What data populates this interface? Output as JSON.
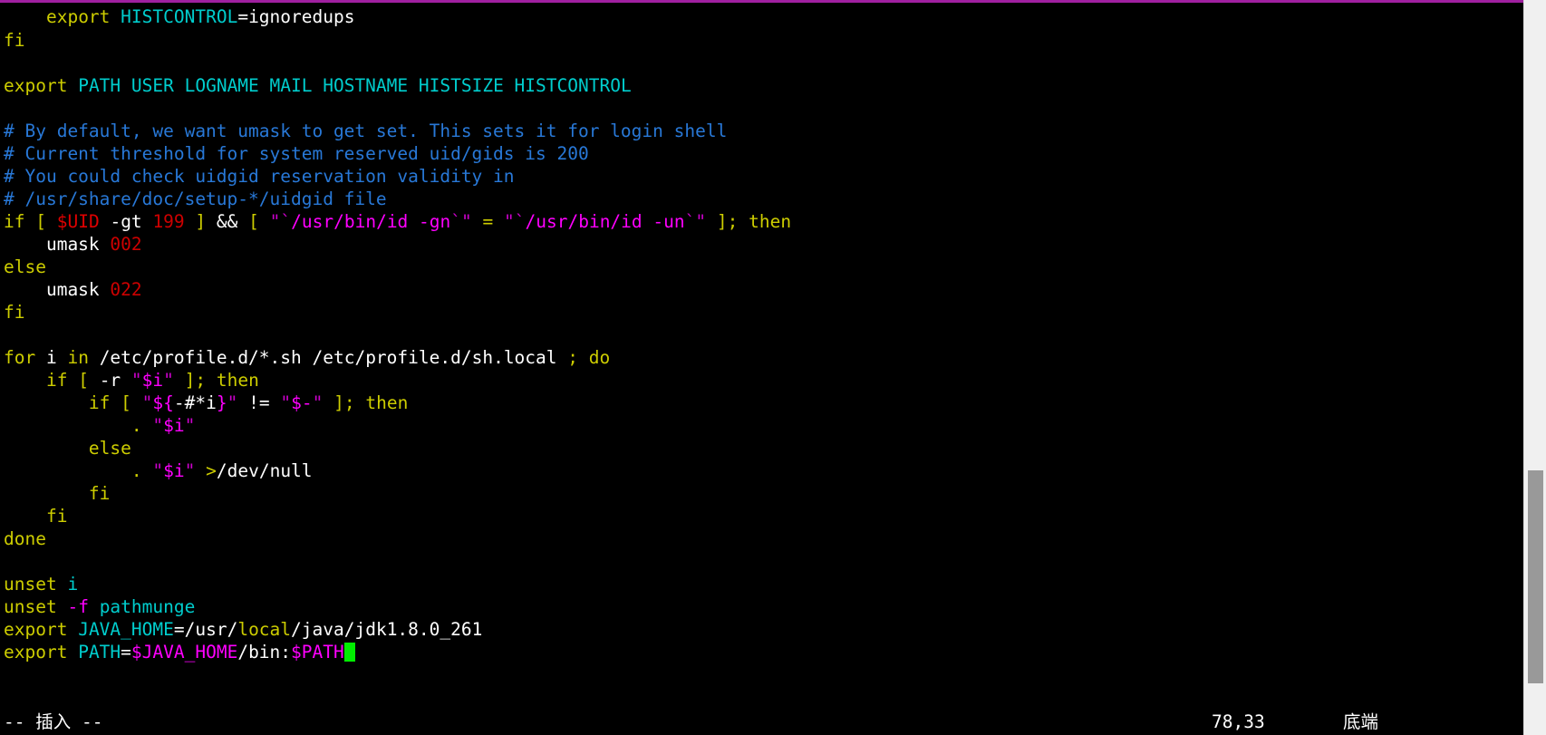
{
  "window": {
    "type": "terminal-vim-editor",
    "accent_color": "#a020a0",
    "background": "#000000",
    "foreground": "#ffffff"
  },
  "editor": {
    "file_syntax": "bash",
    "cursor_glyph": " ",
    "cursor_color": "#00ee00",
    "lines": [
      {
        "id": 1,
        "text": "    export HISTCONTROL=ignoredups",
        "tokens": [
          {
            "t": "    ",
            "c": "plain"
          },
          {
            "t": "export",
            "c": "kw"
          },
          {
            "t": " ",
            "c": "plain"
          },
          {
            "t": "HISTCONTROL",
            "c": "ident"
          },
          {
            "t": "=",
            "c": "plain"
          },
          {
            "t": "ignoredups",
            "c": "plain"
          }
        ]
      },
      {
        "id": 2,
        "text": "fi",
        "tokens": [
          {
            "t": "fi",
            "c": "kw"
          }
        ]
      },
      {
        "id": 3,
        "text": "",
        "tokens": []
      },
      {
        "id": 4,
        "text": "export PATH USER LOGNAME MAIL HOSTNAME HISTSIZE HISTCONTROL",
        "tokens": [
          {
            "t": "export",
            "c": "kw"
          },
          {
            "t": " ",
            "c": "plain"
          },
          {
            "t": "PATH USER LOGNAME MAIL HOSTNAME HISTSIZE HISTCONTROL",
            "c": "ident"
          }
        ]
      },
      {
        "id": 5,
        "text": "",
        "tokens": []
      },
      {
        "id": 6,
        "text": "# By default, we want umask to get set. This sets it for login shell",
        "tokens": [
          {
            "t": "# By default, we want umask to get set. This sets it for login shell",
            "c": "cmt"
          }
        ]
      },
      {
        "id": 7,
        "text": "# Current threshold for system reserved uid/gids is 200",
        "tokens": [
          {
            "t": "# Current threshold for system reserved uid/gids is 200",
            "c": "cmt"
          }
        ]
      },
      {
        "id": 8,
        "text": "# You could check uidgid reservation validity in",
        "tokens": [
          {
            "t": "# You could check uidgid reservation validity in",
            "c": "cmt"
          }
        ]
      },
      {
        "id": 9,
        "text": "# /usr/share/doc/setup-*/uidgid file",
        "tokens": [
          {
            "t": "# /usr/share/doc/setup-*/uidgid file",
            "c": "cmt"
          }
        ]
      },
      {
        "id": 10,
        "text": "if [ $UID -gt 199 ] && [ \"`/usr/bin/id -gn`\" = \"`/usr/bin/id -un`\" ]; then",
        "tokens": [
          {
            "t": "if",
            "c": "kw"
          },
          {
            "t": " ",
            "c": "plain"
          },
          {
            "t": "[",
            "c": "kw"
          },
          {
            "t": " ",
            "c": "plain"
          },
          {
            "t": "$UID",
            "c": "var2"
          },
          {
            "t": " ",
            "c": "plain"
          },
          {
            "t": "-gt",
            "c": "plain"
          },
          {
            "t": " ",
            "c": "plain"
          },
          {
            "t": "199",
            "c": "num"
          },
          {
            "t": " ",
            "c": "plain"
          },
          {
            "t": "]",
            "c": "kw"
          },
          {
            "t": " ",
            "c": "plain"
          },
          {
            "t": "&&",
            "c": "plain"
          },
          {
            "t": " ",
            "c": "plain"
          },
          {
            "t": "[",
            "c": "kw"
          },
          {
            "t": " ",
            "c": "plain"
          },
          {
            "t": "\"",
            "c": "str"
          },
          {
            "t": "`",
            "c": "str"
          },
          {
            "t": "/usr/bin/id -gn",
            "c": "var"
          },
          {
            "t": "`",
            "c": "str"
          },
          {
            "t": "\"",
            "c": "str"
          },
          {
            "t": " ",
            "c": "plain"
          },
          {
            "t": "=",
            "c": "kw"
          },
          {
            "t": " ",
            "c": "plain"
          },
          {
            "t": "\"",
            "c": "str"
          },
          {
            "t": "`",
            "c": "str"
          },
          {
            "t": "/usr/bin/id -un",
            "c": "var"
          },
          {
            "t": "`",
            "c": "str"
          },
          {
            "t": "\"",
            "c": "str"
          },
          {
            "t": " ",
            "c": "plain"
          },
          {
            "t": "]",
            "c": "kw"
          },
          {
            "t": ";",
            "c": "kw"
          },
          {
            "t": " ",
            "c": "plain"
          },
          {
            "t": "then",
            "c": "kw"
          }
        ]
      },
      {
        "id": 11,
        "text": "    umask 002",
        "tokens": [
          {
            "t": "    umask ",
            "c": "plain"
          },
          {
            "t": "002",
            "c": "num"
          }
        ]
      },
      {
        "id": 12,
        "text": "else",
        "tokens": [
          {
            "t": "else",
            "c": "kw"
          }
        ]
      },
      {
        "id": 13,
        "text": "    umask 022",
        "tokens": [
          {
            "t": "    umask ",
            "c": "plain"
          },
          {
            "t": "022",
            "c": "num"
          }
        ]
      },
      {
        "id": 14,
        "text": "fi",
        "tokens": [
          {
            "t": "fi",
            "c": "kw"
          }
        ]
      },
      {
        "id": 15,
        "text": "",
        "tokens": []
      },
      {
        "id": 16,
        "text": "for i in /etc/profile.d/*.sh /etc/profile.d/sh.local ; do",
        "tokens": [
          {
            "t": "for",
            "c": "kw"
          },
          {
            "t": " i ",
            "c": "plain"
          },
          {
            "t": "in",
            "c": "kw"
          },
          {
            "t": " /etc/profile.d/*.sh /etc/profile.d/sh.local ",
            "c": "plain"
          },
          {
            "t": ";",
            "c": "kw"
          },
          {
            "t": " ",
            "c": "plain"
          },
          {
            "t": "do",
            "c": "kw"
          }
        ]
      },
      {
        "id": 17,
        "text": "    if [ -r \"$i\" ]; then",
        "tokens": [
          {
            "t": "    ",
            "c": "plain"
          },
          {
            "t": "if",
            "c": "kw"
          },
          {
            "t": " ",
            "c": "plain"
          },
          {
            "t": "[",
            "c": "kw"
          },
          {
            "t": " -r ",
            "c": "plain"
          },
          {
            "t": "\"",
            "c": "str"
          },
          {
            "t": "$i",
            "c": "var"
          },
          {
            "t": "\"",
            "c": "str"
          },
          {
            "t": " ",
            "c": "plain"
          },
          {
            "t": "]",
            "c": "kw"
          },
          {
            "t": ";",
            "c": "kw"
          },
          {
            "t": " ",
            "c": "plain"
          },
          {
            "t": "then",
            "c": "kw"
          }
        ]
      },
      {
        "id": 18,
        "text": "        if [ \"${-#*i}\" != \"$-\" ]; then",
        "tokens": [
          {
            "t": "        ",
            "c": "plain"
          },
          {
            "t": "if",
            "c": "kw"
          },
          {
            "t": " ",
            "c": "plain"
          },
          {
            "t": "[",
            "c": "kw"
          },
          {
            "t": " ",
            "c": "plain"
          },
          {
            "t": "\"",
            "c": "str"
          },
          {
            "t": "${",
            "c": "var"
          },
          {
            "t": "-#*",
            "c": "plain"
          },
          {
            "t": "i",
            "c": "plain"
          },
          {
            "t": "}",
            "c": "var"
          },
          {
            "t": "\"",
            "c": "str"
          },
          {
            "t": " ",
            "c": "plain"
          },
          {
            "t": "!=",
            "c": "plain"
          },
          {
            "t": " ",
            "c": "plain"
          },
          {
            "t": "\"",
            "c": "str"
          },
          {
            "t": "$-",
            "c": "var"
          },
          {
            "t": "\"",
            "c": "str"
          },
          {
            "t": " ",
            "c": "plain"
          },
          {
            "t": "]",
            "c": "kw"
          },
          {
            "t": ";",
            "c": "kw"
          },
          {
            "t": " ",
            "c": "plain"
          },
          {
            "t": "then",
            "c": "kw"
          }
        ]
      },
      {
        "id": 19,
        "text": "            . \"$i\"",
        "tokens": [
          {
            "t": "            ",
            "c": "plain"
          },
          {
            "t": ".",
            "c": "kw"
          },
          {
            "t": " ",
            "c": "plain"
          },
          {
            "t": "\"",
            "c": "str"
          },
          {
            "t": "$i",
            "c": "var"
          },
          {
            "t": "\"",
            "c": "str"
          }
        ]
      },
      {
        "id": 20,
        "text": "        else",
        "tokens": [
          {
            "t": "        ",
            "c": "plain"
          },
          {
            "t": "else",
            "c": "kw"
          }
        ]
      },
      {
        "id": 21,
        "text": "            . \"$i\" >/dev/null",
        "tokens": [
          {
            "t": "            ",
            "c": "plain"
          },
          {
            "t": ".",
            "c": "kw"
          },
          {
            "t": " ",
            "c": "plain"
          },
          {
            "t": "\"",
            "c": "str"
          },
          {
            "t": "$i",
            "c": "var"
          },
          {
            "t": "\"",
            "c": "str"
          },
          {
            "t": " ",
            "c": "plain"
          },
          {
            "t": ">",
            "c": "kw"
          },
          {
            "t": "/dev/null",
            "c": "plain"
          }
        ]
      },
      {
        "id": 22,
        "text": "        fi",
        "tokens": [
          {
            "t": "        ",
            "c": "plain"
          },
          {
            "t": "fi",
            "c": "kw"
          }
        ]
      },
      {
        "id": 23,
        "text": "    fi",
        "tokens": [
          {
            "t": "    ",
            "c": "plain"
          },
          {
            "t": "fi",
            "c": "kw"
          }
        ]
      },
      {
        "id": 24,
        "text": "done",
        "tokens": [
          {
            "t": "done",
            "c": "kw"
          }
        ]
      },
      {
        "id": 25,
        "text": "",
        "tokens": []
      },
      {
        "id": 26,
        "text": "unset i",
        "tokens": [
          {
            "t": "unset",
            "c": "kw"
          },
          {
            "t": " ",
            "c": "plain"
          },
          {
            "t": "i",
            "c": "ident"
          }
        ]
      },
      {
        "id": 27,
        "text": "unset -f pathmunge",
        "tokens": [
          {
            "t": "unset",
            "c": "kw"
          },
          {
            "t": " ",
            "c": "plain"
          },
          {
            "t": "-f",
            "c": "var"
          },
          {
            "t": " ",
            "c": "plain"
          },
          {
            "t": "pathmunge",
            "c": "ident"
          }
        ]
      },
      {
        "id": 28,
        "text": "export JAVA_HOME=/usr/local/java/jdk1.8.0_261",
        "tokens": [
          {
            "t": "export",
            "c": "kw"
          },
          {
            "t": " ",
            "c": "plain"
          },
          {
            "t": "JAVA_HOME",
            "c": "ident"
          },
          {
            "t": "=",
            "c": "plain"
          },
          {
            "t": "/usr/",
            "c": "plain"
          },
          {
            "t": "local",
            "c": "kw"
          },
          {
            "t": "/java/jdk1.8.0_261",
            "c": "plain"
          }
        ]
      },
      {
        "id": 29,
        "text": "export PATH=$JAVA_HOME/bin:$PATH",
        "cursor_at_end": true,
        "tokens": [
          {
            "t": "export",
            "c": "kw"
          },
          {
            "t": " ",
            "c": "plain"
          },
          {
            "t": "PATH",
            "c": "ident"
          },
          {
            "t": "=",
            "c": "plain"
          },
          {
            "t": "$JAVA_HOME",
            "c": "var"
          },
          {
            "t": "/bin:",
            "c": "plain"
          },
          {
            "t": "$PATH",
            "c": "var"
          }
        ]
      }
    ]
  },
  "statusline": {
    "mode": "-- 插入 --",
    "position": "78,33",
    "location": "底端"
  },
  "scrollbar": {
    "thumb_top_pct": 64,
    "thumb_height_pct": 29,
    "track_color": "#f0f0f0",
    "thumb_color": "#999999"
  }
}
